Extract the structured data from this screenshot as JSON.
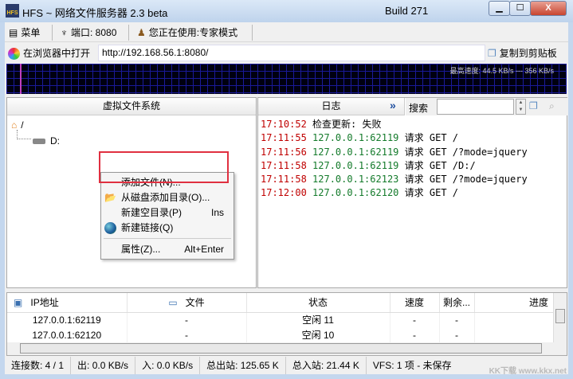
{
  "window": {
    "title": "HFS ~ 网络文件服务器 2.3 beta",
    "build": "Build 271",
    "app_icon": "HFS"
  },
  "toolbar": {
    "menu": "菜单",
    "port": "端口: 8080",
    "mode": "您正在使用:专家模式"
  },
  "address": {
    "open_browser": "在浏览器中打开",
    "url": "http://192.168.56.1:8080/",
    "copy": "复制到剪贴板"
  },
  "graph": {
    "label": "最高速度: 44.5 KB/s --- 356 KB/s"
  },
  "vfs": {
    "header": "虚拟文件系统",
    "root": "/",
    "child": "D:"
  },
  "context_menu": {
    "items": [
      {
        "label": "添加文件(N)...",
        "shortcut": ""
      },
      {
        "label": "从磁盘添加目录(O)...",
        "shortcut": ""
      },
      {
        "label": "新建空目录(P)",
        "shortcut": "Ins"
      },
      {
        "label": "新建链接(Q)",
        "shortcut": ""
      },
      {
        "label": "属性(Z)...",
        "shortcut": "Alt+Enter"
      }
    ]
  },
  "log": {
    "header": "日志",
    "search_label": "搜索",
    "search_value": "",
    "entries": [
      {
        "time": "17:10:52",
        "ip": "",
        "msg": "检查更新: 失败"
      },
      {
        "time": "17:11:55",
        "ip": "127.0.0.1:62119",
        "msg": "请求 GET /"
      },
      {
        "time": "17:11:56",
        "ip": "127.0.0.1:62119",
        "msg": "请求 GET /?mode=jquery"
      },
      {
        "time": "17:11:58",
        "ip": "127.0.0.1:62119",
        "msg": "请求 GET /D:/"
      },
      {
        "time": "17:11:58",
        "ip": "127.0.0.1:62123",
        "msg": "请求 GET /?mode=jquery"
      },
      {
        "time": "17:12:00",
        "ip": "127.0.0.1:62120",
        "msg": "请求 GET /"
      }
    ]
  },
  "connections": {
    "columns": [
      "IP地址",
      "文件",
      "状态",
      "速度",
      "剩余...",
      "进度"
    ],
    "rows": [
      [
        "127.0.0.1:62119",
        "-",
        "空闲 11",
        "-",
        "-",
        ""
      ],
      [
        "127.0.0.1:62120",
        "-",
        "空闲 10",
        "-",
        "-",
        ""
      ]
    ]
  },
  "status": [
    "连接数: 4 / 1",
    "出: 0.0 KB/s",
    "入: 0.0 KB/s",
    "总出站: 125.65 K",
    "总入站: 21.44 K",
    "VFS: 1 项 - 未保存"
  ],
  "watermark": "KK下载 www.kkx.net"
}
